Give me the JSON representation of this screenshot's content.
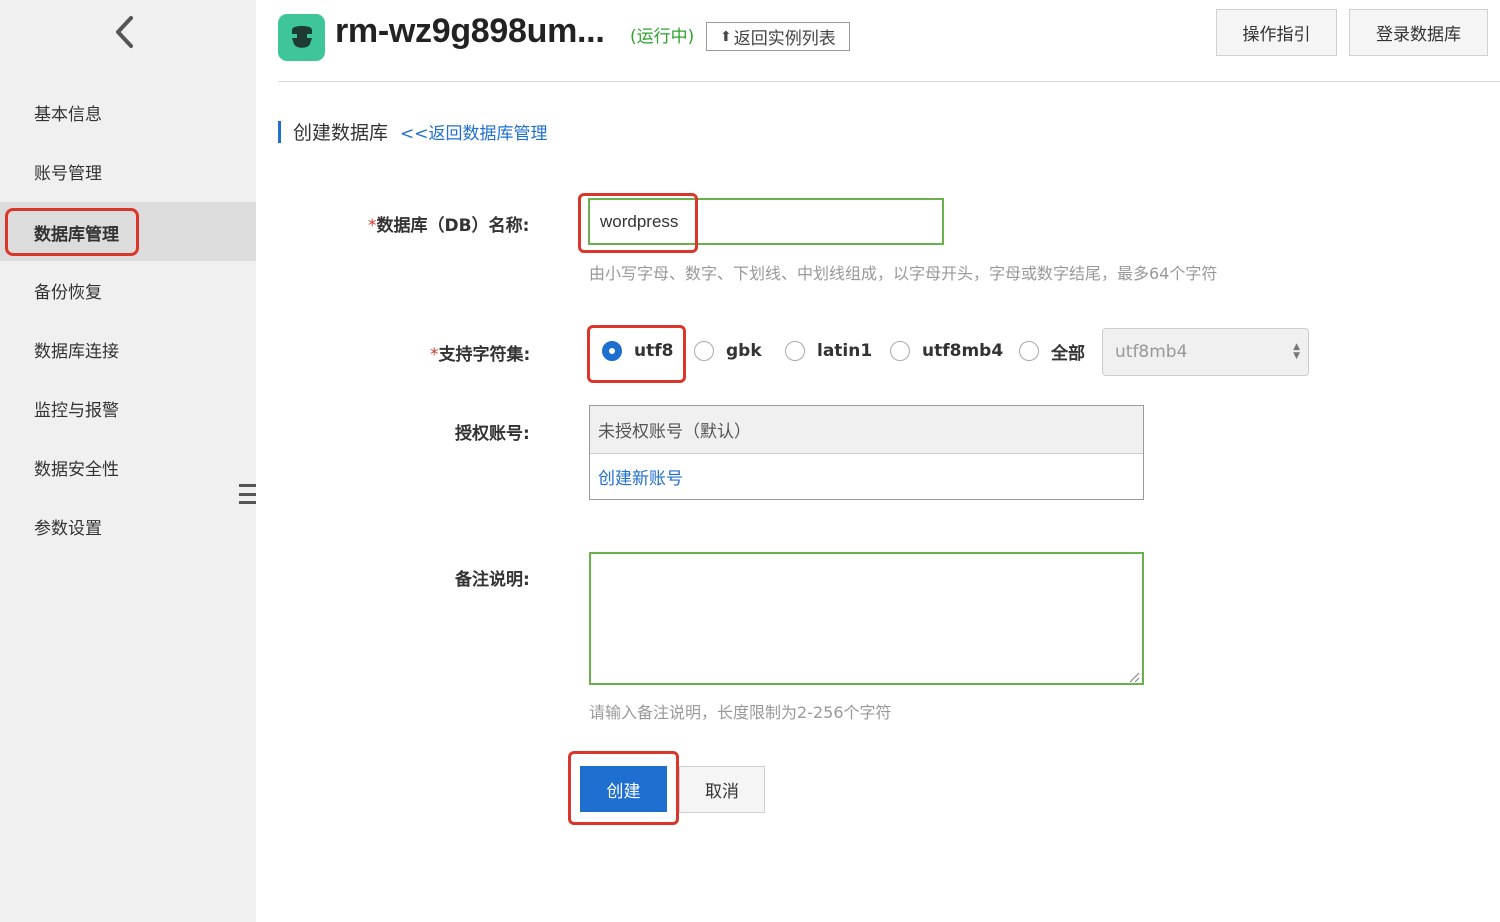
{
  "sidebar": {
    "items": [
      {
        "label": "基本信息"
      },
      {
        "label": "账号管理"
      },
      {
        "label": "数据库管理"
      },
      {
        "label": "备份恢复"
      },
      {
        "label": "数据库连接"
      },
      {
        "label": "监控与报警"
      },
      {
        "label": "数据安全性"
      },
      {
        "label": "参数设置"
      }
    ],
    "active": "数据库管理"
  },
  "header": {
    "instance_name": "rm-wz9g898um...",
    "status": "(运行中)",
    "return_list": "返回实例列表",
    "guide_button": "操作指引",
    "login_button": "登录数据库"
  },
  "section": {
    "title": "创建数据库",
    "back_link": "<<返回数据库管理"
  },
  "form": {
    "db_name": {
      "required_mark": "*",
      "label": "数据库（DB）名称:",
      "value": "wordpress",
      "hint": "由小写字母、数字、下划线、中划线组成，以字母开头，字母或数字结尾，最多64个字符"
    },
    "charset": {
      "required_mark": "*",
      "label": "支持字符集:",
      "options": [
        {
          "label": "utf8",
          "checked": true
        },
        {
          "label": "gbk",
          "checked": false
        },
        {
          "label": "latin1",
          "checked": false
        },
        {
          "label": "utf8mb4",
          "checked": false
        },
        {
          "label": "全部",
          "checked": false
        }
      ],
      "select_value": "utf8mb4"
    },
    "account": {
      "label": "授权账号:",
      "default_option": "未授权账号（默认）",
      "create_link": "创建新账号"
    },
    "remark": {
      "label": "备注说明:",
      "value": "",
      "hint": "请输入备注说明，长度限制为2-256个字符"
    },
    "create_button": "创建",
    "cancel_button": "取消"
  },
  "colors": {
    "primary": "#1f6fd0",
    "highlight": "#d9372b",
    "status_green": "#2da52d",
    "logo_green": "#3fc59a",
    "input_border_green": "#6ab04c"
  }
}
